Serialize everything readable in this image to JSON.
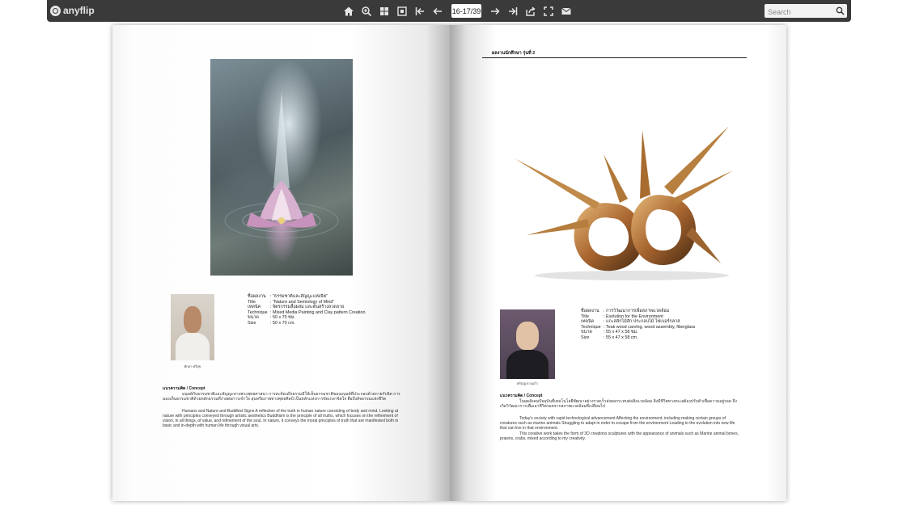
{
  "toolbar": {
    "logo_text": "anyflip",
    "page_indicator": "16-17/39",
    "search_placeholder": "Search",
    "icons": [
      "home-icon",
      "zoom-in-icon",
      "thumbnails-icon",
      "fit-page-icon",
      "first-page-icon",
      "previous-page-icon",
      "next-page-icon",
      "last-page-icon",
      "share-icon",
      "fullscreen-icon",
      "email-icon"
    ]
  },
  "left_page": {
    "portrait_caption": "ศักดา ศรีสุข",
    "meta": [
      {
        "k": "ชื่อผลงาน",
        "v": ": \"ธรรมชาติและสัญญะแห่งจิต\""
      },
      {
        "k": "Title",
        "v": ": \"Nature and Semiology of Mind\""
      },
      {
        "k": "เทคนิค",
        "v": ": จิตรกรรมสื่อผสม และดินสร้างลวดลาย"
      },
      {
        "k": "Technique",
        "v": ": Mixed Media Painting and Clay pattern Creation"
      },
      {
        "k": "ขนาด",
        "v": ": 50 x 70 ซม."
      },
      {
        "k": "Size",
        "v": ": 50 x 70 cm."
      }
    ],
    "concept_heading": "แนวความคิด / Concept",
    "concept_th": "มนุษย์กับธรรมชาติและสัญญะทางพระพุทธศาสนา การสะท้อนถึงธรรมมีให้เห็นธรรมชาติของมนุษย์ที่ประกอบด้วยกายกับจิต การมองเห็นธรรมชาติด้วยหลักธรรมที่ง่ายต่อการเข้าใจ สุนทรียภาพทางพุทธศิลป์ เป็นหลักแห่งการขัดเกลาจิตใจ สื่อถึงสัจธรรมแห่งชีวิต",
    "concept_en": "Humans and Nature and Buddhist Signs A reflection of the truth in human nature consisting of body and mind. Looking at nature with principles conveyed through artistic aesthetics Buddhism is the principle of all truths, which focuses on the refinement of vision, in all things, of value, and refinement of the soul. In nature, it conveys the moral principles of truth that are manifested both in basic and in-depth with human life through visual arts."
  },
  "right_page": {
    "header": "ผลงานนักศึกษา รุ่นที่ 2",
    "portrait_caption": "ศรัณยู ดวงแก้ว",
    "meta": [
      {
        "k": "ชื่อผลงาน",
        "v": ": การวิวัฒนาการเพื่อสภาพแวดล้อม"
      },
      {
        "k": "Title",
        "v": ": Evolution for the Environment"
      },
      {
        "k": "เทคนิค",
        "v": ": แกะสลักไม้สัก ประกอบไม้ ไฟเบอร์กลาส"
      },
      {
        "k": "Technique",
        "v": ": Teak wood carving, wood assembly, fiberglass"
      },
      {
        "k": "ขนาด",
        "v": ": 55 x 47 x 58 ซม."
      },
      {
        "k": "Size",
        "v": ": 55 x 47 x 58 cm."
      }
    ],
    "concept_heading": "แนวความคิด / Concept",
    "concept_th": "ในยุคสังคมปัจจุบันที่เทคโนโลยีพัฒนาอย่างรวดเร็วส่งผลกระทบต่อสิ่งแวดล้อม สิ่งมีชีวิตทางทะเลต้องปรับตัวเพื่อความอยู่รอด จึงเกิดวิวัฒนาการเพื่อเอาชีวิตรอดจากสภาพแวดล้อมที่เปลี่ยนไป",
    "concept_en_1": "Today's society with rapid technological advancement Affecting the environment, including making certain groups of creatures such as marine animals Struggling to adapt in order to escape from the environment Leading to the evolution into new life that can live in that environment.",
    "concept_en_2": "This creative work takes the form of 3D creations sculptures with the appearance of animals such as Marine animal bones, prawns, crabs, mixed according to my creativity."
  }
}
